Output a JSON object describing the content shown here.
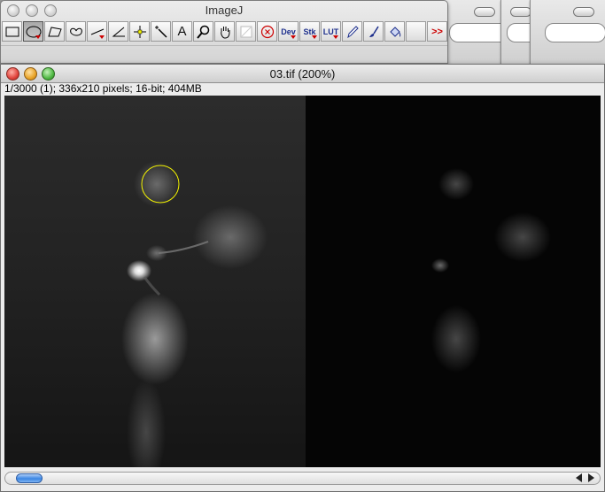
{
  "toolbar_window": {
    "title": "ImageJ",
    "tools": [
      {
        "name": "rectangle",
        "icon": "rectangle-icon",
        "selected": false
      },
      {
        "name": "oval",
        "icon": "oval-icon",
        "selected": true,
        "has_menu": true
      },
      {
        "name": "polygon",
        "icon": "polygon-icon",
        "selected": false
      },
      {
        "name": "freehand",
        "icon": "freehand-icon",
        "selected": false
      },
      {
        "name": "line",
        "icon": "line-icon",
        "selected": false,
        "has_menu": true
      },
      {
        "name": "angle",
        "icon": "angle-icon",
        "selected": false
      },
      {
        "name": "point",
        "icon": "point-icon",
        "selected": false
      },
      {
        "name": "wand",
        "icon": "wand-icon",
        "selected": false
      },
      {
        "name": "text",
        "icon": "text-icon",
        "selected": false,
        "label": "A"
      },
      {
        "name": "magnifier",
        "icon": "magnifier-icon",
        "selected": false
      },
      {
        "name": "hand",
        "icon": "hand-icon",
        "selected": false
      },
      {
        "name": "color-picker",
        "icon": "color-picker-icon",
        "selected": false
      },
      {
        "name": "close-tool",
        "icon": "close-circle-icon",
        "selected": false
      },
      {
        "name": "dev",
        "icon": "dev-menu-icon",
        "selected": false,
        "label": "Dev",
        "has_menu": true
      },
      {
        "name": "stk",
        "icon": "stack-menu-icon",
        "selected": false,
        "label": "Stk",
        "has_menu": true
      },
      {
        "name": "lut",
        "icon": "lut-menu-icon",
        "selected": false,
        "label": "LUT",
        "has_menu": true
      },
      {
        "name": "pencil",
        "icon": "pencil-icon",
        "selected": false
      },
      {
        "name": "brush",
        "icon": "brush-icon",
        "selected": false
      },
      {
        "name": "flood-fill",
        "icon": "flood-fill-icon",
        "selected": false
      },
      {
        "name": "empty",
        "icon": "",
        "selected": false
      },
      {
        "name": "more",
        "icon": "more-tools-icon",
        "selected": false,
        "label": ">>"
      }
    ]
  },
  "image_window": {
    "title": "03.tif (200%)",
    "info": "1/3000 (1); 336x210 pixels; 16-bit; 404MB"
  },
  "colors": {
    "close": "#e0433c",
    "minimize": "#e8a428",
    "zoom": "#4fb843",
    "roi": "#f4f400"
  }
}
